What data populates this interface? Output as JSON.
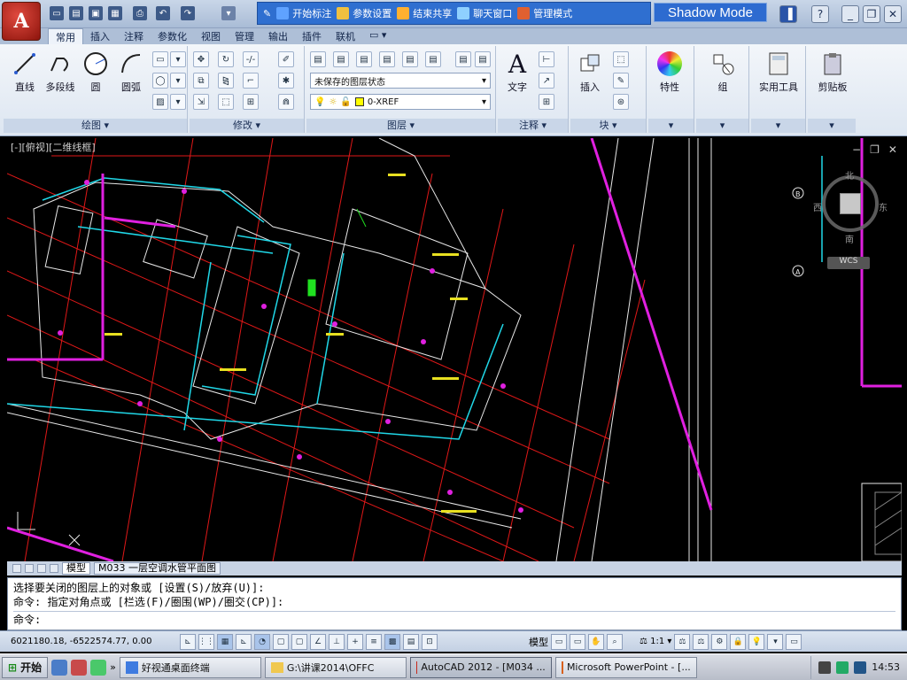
{
  "app": {
    "logo_letter": "A",
    "quick_access_icons": [
      "new-icon",
      "open-icon",
      "save-icon",
      "saveas-icon",
      "print-icon",
      "undo-icon",
      "redo-icon",
      "dropdown-icon"
    ]
  },
  "collab_bar": {
    "buttons": [
      {
        "label": "开始标注",
        "icon": "pen-icon"
      },
      {
        "label": "参数设置",
        "icon": "settings-icon"
      },
      {
        "label": "结束共享",
        "icon": "stop-share-icon"
      },
      {
        "label": "聊天窗口",
        "icon": "chat-icon"
      },
      {
        "label": "管理模式",
        "icon": "admin-icon"
      }
    ],
    "shadow_mode": "Shadow Mode"
  },
  "ribbon_tabs": [
    {
      "label": "常用",
      "active": true
    },
    {
      "label": "插入",
      "active": false
    },
    {
      "label": "注释",
      "active": false
    },
    {
      "label": "参数化",
      "active": false
    },
    {
      "label": "视图",
      "active": false
    },
    {
      "label": "管理",
      "active": false
    },
    {
      "label": "输出",
      "active": false
    },
    {
      "label": "插件",
      "active": false
    },
    {
      "label": "联机",
      "active": false
    }
  ],
  "ribbon": {
    "draw": {
      "label": "绘图",
      "buttons": [
        "直线",
        "多段线",
        "圆",
        "圆弧"
      ]
    },
    "modify": {
      "label": "修改"
    },
    "layers": {
      "label": "图层",
      "layer_state": "未保存的图层状态",
      "current_layer": "0-XREF"
    },
    "annotation": {
      "label": "注释",
      "text_button": "文字",
      "text_icon_glyph": "A"
    },
    "block": {
      "label": "块",
      "insert_button": "插入"
    },
    "properties": {
      "button": "特性"
    },
    "group": {
      "button": "组"
    },
    "utilities": {
      "button": "实用工具"
    },
    "clipboard": {
      "button": "剪贴板"
    }
  },
  "viewport": {
    "label": "[-][俯视][二维线框]",
    "viewcube": {
      "north": "北",
      "south": "南",
      "east": "东",
      "west": "西",
      "wcs": "WCS"
    },
    "grid_labels": [
      "B",
      "A"
    ]
  },
  "layout_tabs": {
    "model": "模型",
    "layout": "M033 一层空调水管平面图"
  },
  "command": {
    "line1": "选择要关闭的图层上的对象或 [设置(S)/放弃(U)]:",
    "line2": "命令: 指定对角点或 [栏选(F)/圈围(WP)/圈交(CP)]:",
    "prompt": "命令:"
  },
  "status": {
    "coords": "6021180.18, -6522574.77, 0.00",
    "model_label": "模型",
    "scale": "1:1"
  },
  "taskbar": {
    "start": "开始",
    "tasks": [
      {
        "label": "好视通桌面终端",
        "active": false
      },
      {
        "label": "G:\\讲课2014\\OFFC",
        "active": false
      },
      {
        "label": "AutoCAD 2012 - [M034 ...",
        "active": true
      },
      {
        "label": "Microsoft PowerPoint - [...",
        "active": false
      }
    ],
    "clock": "14:53"
  },
  "colors": {
    "cad_bg": "#000000",
    "red": "#e01818",
    "magenta": "#e020e0",
    "cyan": "#20d8e8",
    "white": "#e8e8e8",
    "green": "#20e020",
    "yellow": "#e8e020"
  }
}
